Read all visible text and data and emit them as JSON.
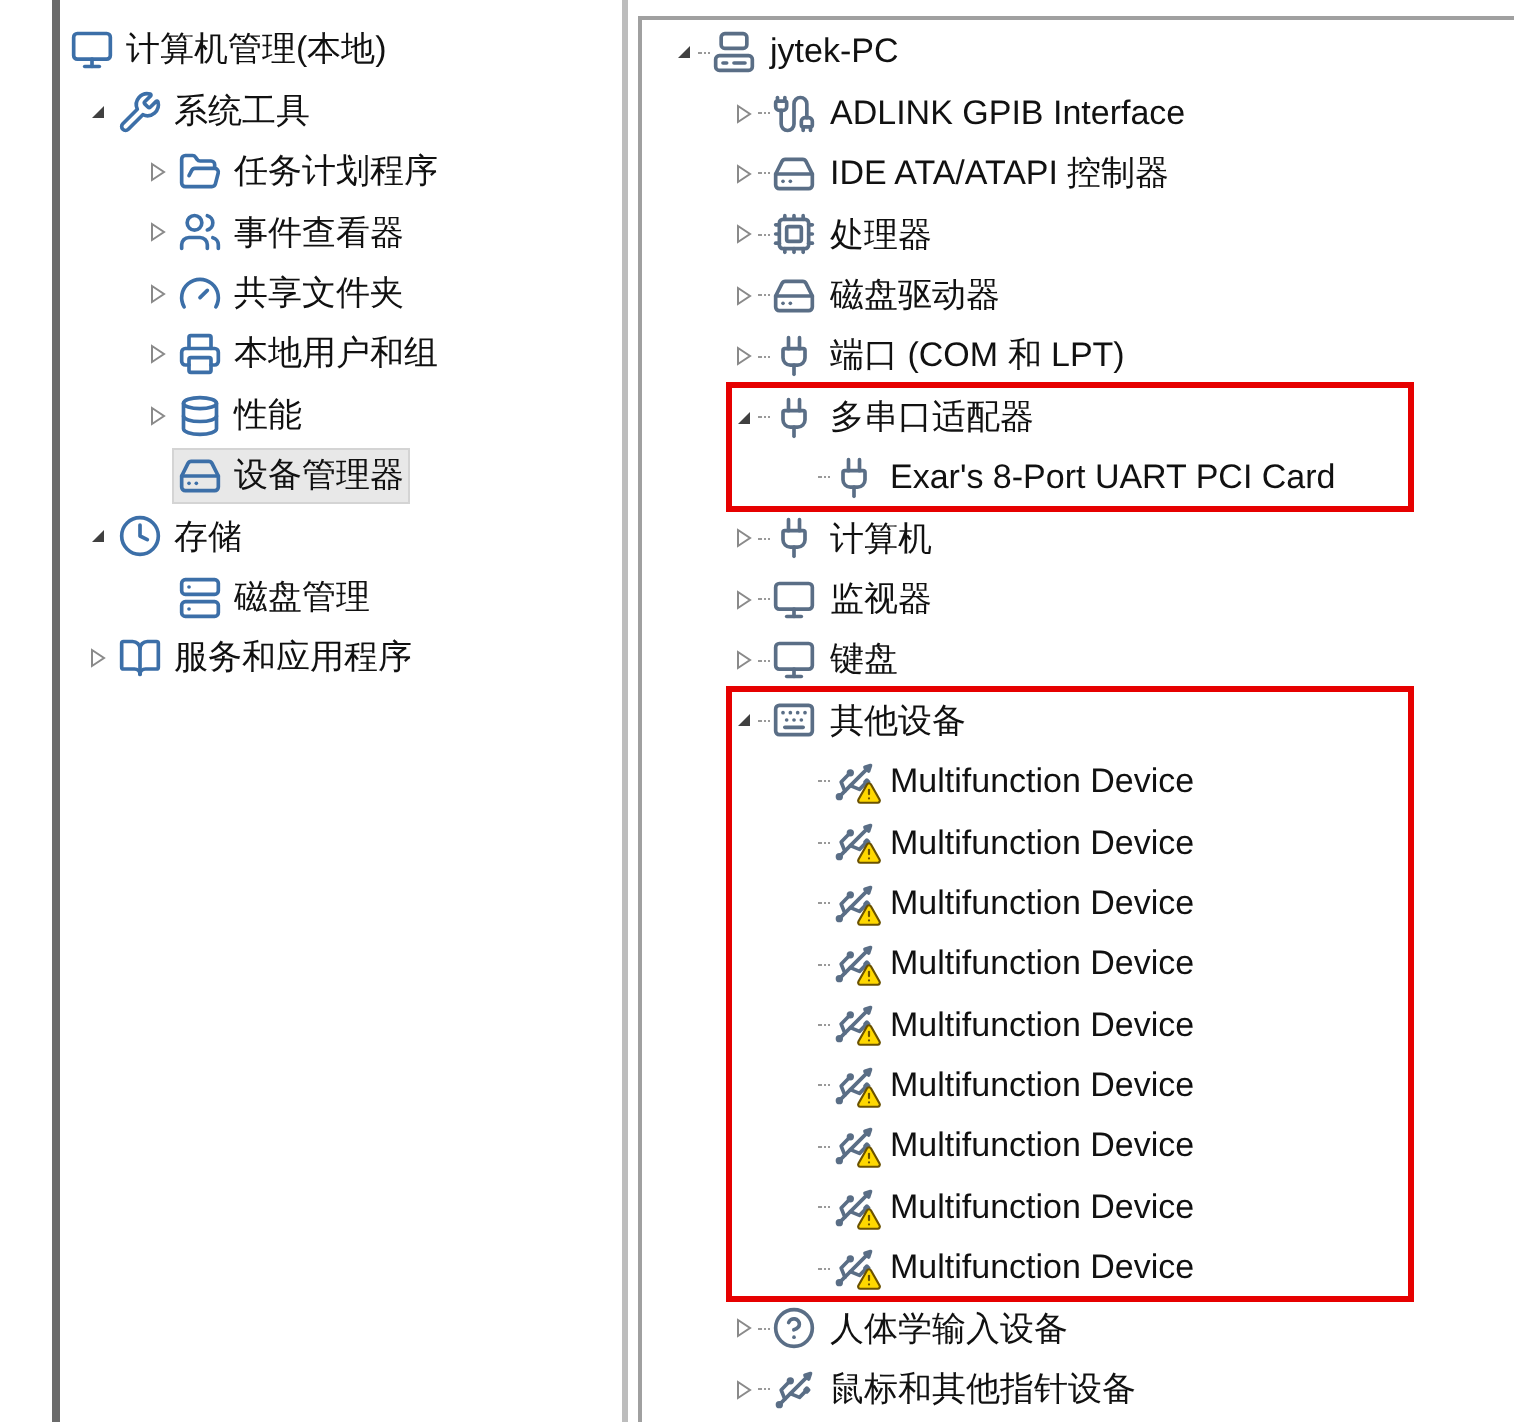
{
  "console_tree": [
    {
      "label": "计算机管理(本地)",
      "selected": false,
      "children": [
        {
          "label": "系统工具",
          "expanded": true,
          "selected": false,
          "children": [
            {
              "label": "任务计划程序",
              "expanded": false,
              "selected": false
            },
            {
              "label": "事件查看器",
              "expanded": false,
              "selected": false
            },
            {
              "label": "共享文件夹",
              "expanded": false,
              "selected": false
            },
            {
              "label": "本地用户和组",
              "expanded": false,
              "selected": false
            },
            {
              "label": "性能",
              "expanded": false,
              "selected": false
            },
            {
              "label": "设备管理器",
              "selected": true
            }
          ]
        },
        {
          "label": "存储",
          "expanded": true,
          "selected": false,
          "children": [
            {
              "label": "磁盘管理",
              "selected": false
            }
          ]
        },
        {
          "label": "服务和应用程序",
          "expanded": false,
          "selected": false
        }
      ]
    }
  ],
  "device_tree": [
    {
      "label": "jytek-PC",
      "expanded": true,
      "children": [
        {
          "label": "ADLINK GPIB Interface",
          "expanded": false
        },
        {
          "label": "IDE ATA/ATAPI 控制器",
          "expanded": false
        },
        {
          "label": "处理器",
          "expanded": false
        },
        {
          "label": "磁盘驱动器",
          "expanded": false
        },
        {
          "label": "端口 (COM 和 LPT)",
          "expanded": false
        },
        {
          "label": "多串口适配器",
          "expanded": true,
          "highlighted": true,
          "children": [
            {
              "label": "Exar's 8-Port UART PCI Card",
              "warning": false
            }
          ]
        },
        {
          "label": "计算机",
          "expanded": false
        },
        {
          "label": "监视器",
          "expanded": false
        },
        {
          "label": "键盘",
          "expanded": false
        },
        {
          "label": "其他设备",
          "expanded": true,
          "highlighted": true,
          "children": [
            {
              "label": "Multifunction Device",
              "warning": true
            },
            {
              "label": "Multifunction Device",
              "warning": true
            },
            {
              "label": "Multifunction Device",
              "warning": true
            },
            {
              "label": "Multifunction Device",
              "warning": true
            },
            {
              "label": "Multifunction Device",
              "warning": true
            },
            {
              "label": "Multifunction Device",
              "warning": true
            },
            {
              "label": "Multifunction Device",
              "warning": true
            },
            {
              "label": "Multifunction Device",
              "warning": true
            },
            {
              "label": "Multifunction Device",
              "warning": true
            }
          ]
        },
        {
          "label": "人体学输入设备",
          "expanded": false
        },
        {
          "label": "鼠标和其他指针设备",
          "expanded": false
        }
      ]
    }
  ]
}
